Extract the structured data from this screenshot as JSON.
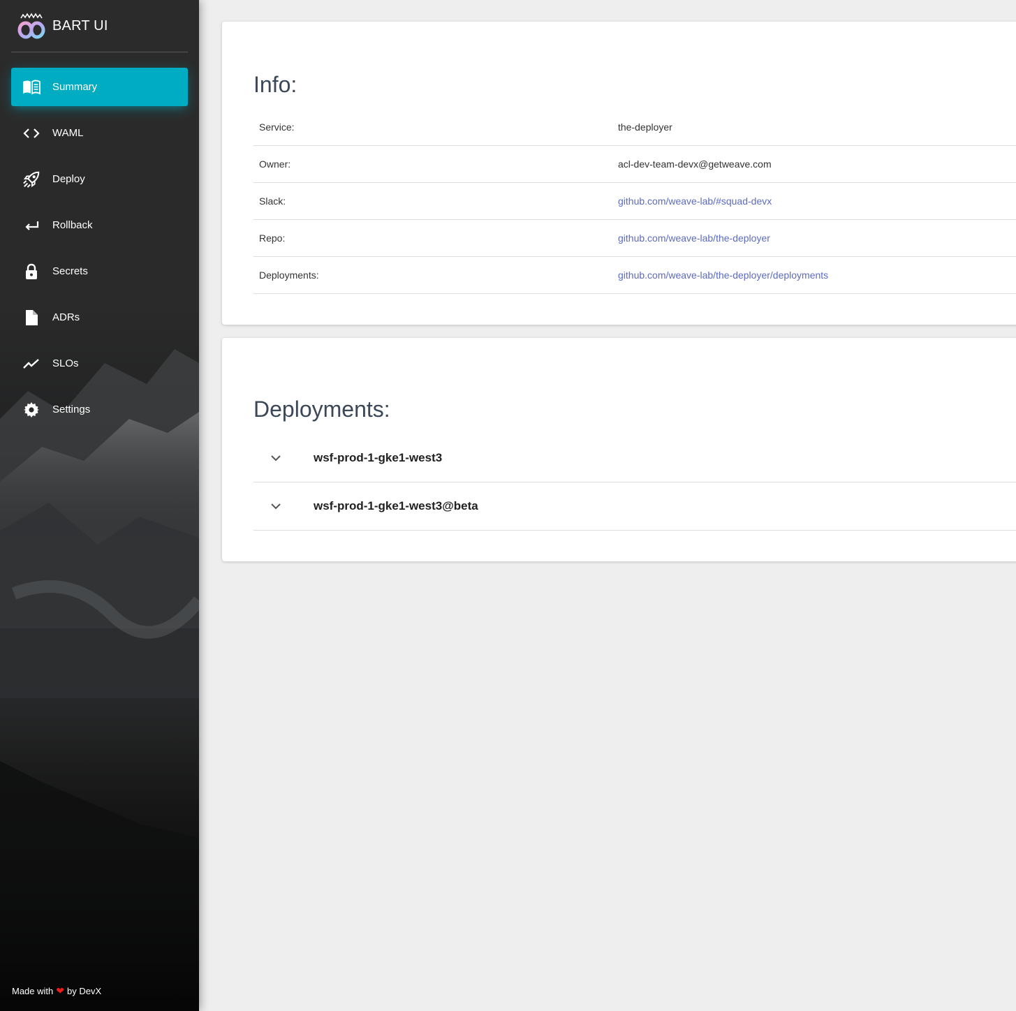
{
  "app": {
    "title": "BART UI",
    "accent_color": "#00acc1",
    "link_color": "#5c6bc0",
    "logo_icon": "infinity-crown-logo"
  },
  "sidebar": {
    "items": [
      {
        "label": "Summary",
        "icon": "book-open-icon",
        "active": true
      },
      {
        "label": "WAML",
        "icon": "code-icon",
        "active": false
      },
      {
        "label": "Deploy",
        "icon": "rocket-icon",
        "active": false
      },
      {
        "label": "Rollback",
        "icon": "return-arrow-icon",
        "active": false
      },
      {
        "label": "Secrets",
        "icon": "lock-icon",
        "active": false
      },
      {
        "label": "ADRs",
        "icon": "document-icon",
        "active": false
      },
      {
        "label": "SLOs",
        "icon": "trending-line-icon",
        "active": false
      },
      {
        "label": "Settings",
        "icon": "gear-icon",
        "active": false
      }
    ],
    "footer": {
      "prefix": "Made with",
      "icon": "heart-icon",
      "suffix": "by DevX"
    }
  },
  "info": {
    "title": "Info:",
    "rows": [
      {
        "key": "Service:",
        "value": "the-deployer",
        "link": false
      },
      {
        "key": "Owner:",
        "value": "acl-dev-team-devx@getweave.com",
        "link": false
      },
      {
        "key": "Slack:",
        "value": "github.com/weave-lab/#squad-devx",
        "link": true
      },
      {
        "key": "Repo:",
        "value": "github.com/weave-lab/the-deployer",
        "link": true
      },
      {
        "key": "Deployments:",
        "value": "github.com/weave-lab/the-deployer/deployments",
        "link": true
      }
    ]
  },
  "deployments": {
    "title": "Deployments:",
    "items": [
      {
        "name": "wsf-prod-1-gke1-west3",
        "icon": "chevron-down-icon"
      },
      {
        "name": "wsf-prod-1-gke1-west3@beta",
        "icon": "chevron-down-icon"
      }
    ]
  }
}
